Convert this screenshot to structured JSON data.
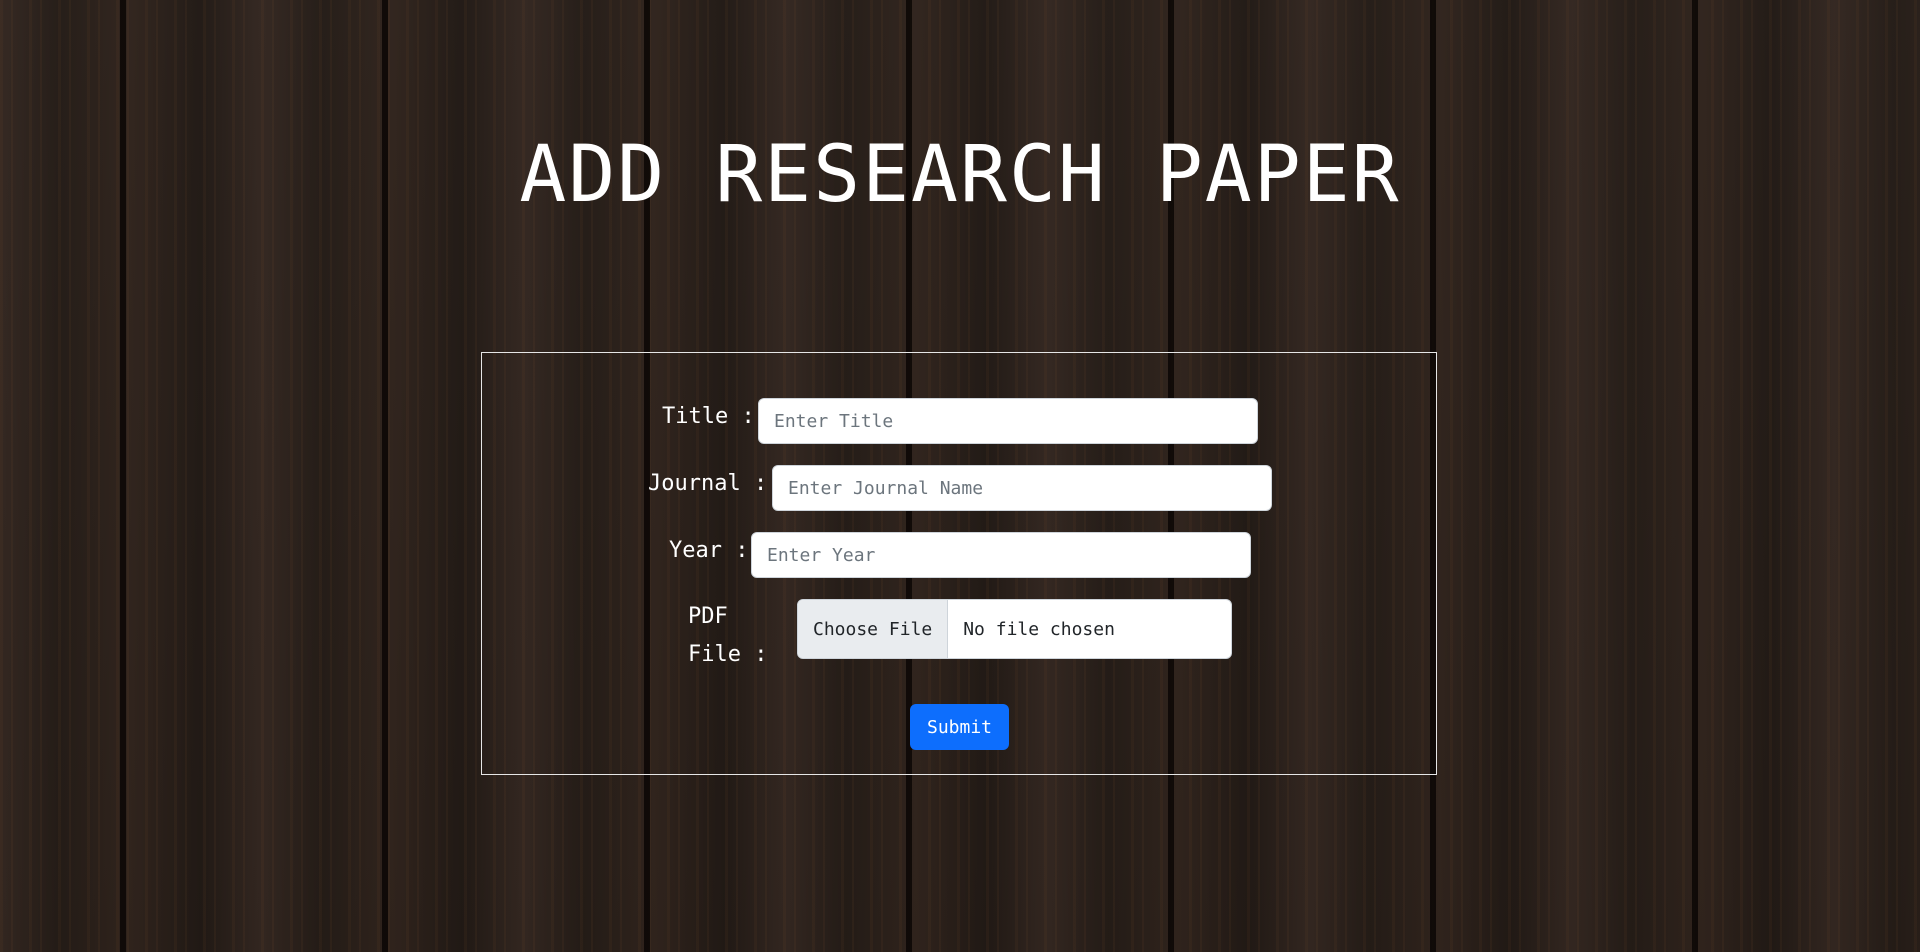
{
  "page": {
    "title": "ADD RESEARCH PAPER"
  },
  "form": {
    "title_label": "Title :",
    "title_placeholder": "Enter Title",
    "title_value": "",
    "journal_label": "Journal :",
    "journal_placeholder": "Enter Journal Name",
    "journal_value": "",
    "year_label": "Year :",
    "year_placeholder": "Enter Year",
    "year_value": "",
    "pdf_label_line1": "PDF",
    "pdf_label_line2": "File :",
    "file_button_label": "Choose File",
    "file_status": "No file chosen",
    "submit_label": "Submit"
  },
  "colors": {
    "submit_button": "#0d6efd",
    "text": "#ffffff",
    "form_border": "#e6e6e6"
  }
}
